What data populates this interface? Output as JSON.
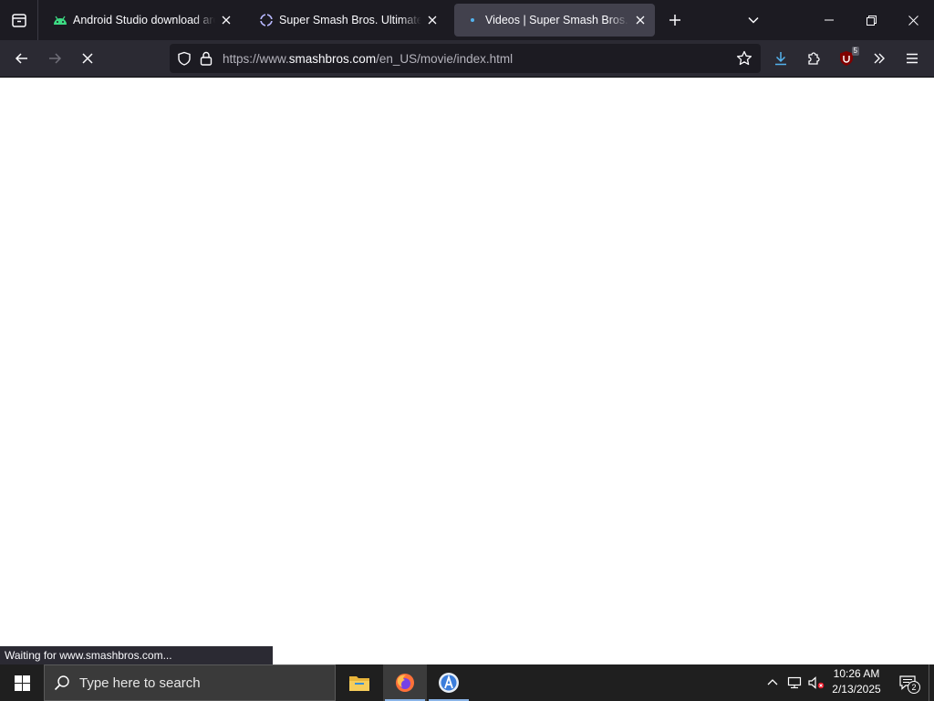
{
  "browser": {
    "tabs": [
      {
        "title": "Android Studio download archives",
        "favicon": "android-icon",
        "active": false
      },
      {
        "title": "Super Smash Bros. Ultimate - Super Smash Bros.",
        "favicon": "smash-icon",
        "active": false
      },
      {
        "title": "Videos | Super Smash Bros. Ultimate",
        "favicon": "loading-dot-icon",
        "active": true
      }
    ],
    "url": {
      "prefix": "https://www.",
      "domain": "smashbros.com",
      "path": "/en_US/movie/index.html"
    },
    "extension_badge": "5",
    "status_text": "Waiting for www.smashbros.com..."
  },
  "taskbar": {
    "search_placeholder": "Type here to search",
    "apps": [
      "file-explorer-icon",
      "firefox-icon",
      "android-studio-icon"
    ],
    "time": "10:26 AM",
    "date": "2/13/2025",
    "notification_count": "2"
  },
  "colors": {
    "tabstrip_bg": "#1c1b22",
    "navbar_bg": "#2b2a33",
    "active_tab": "#42414d",
    "download_accent": "#54b3ee",
    "ublock_red": "#800000",
    "taskbar_bg": "#1f1f1f"
  }
}
